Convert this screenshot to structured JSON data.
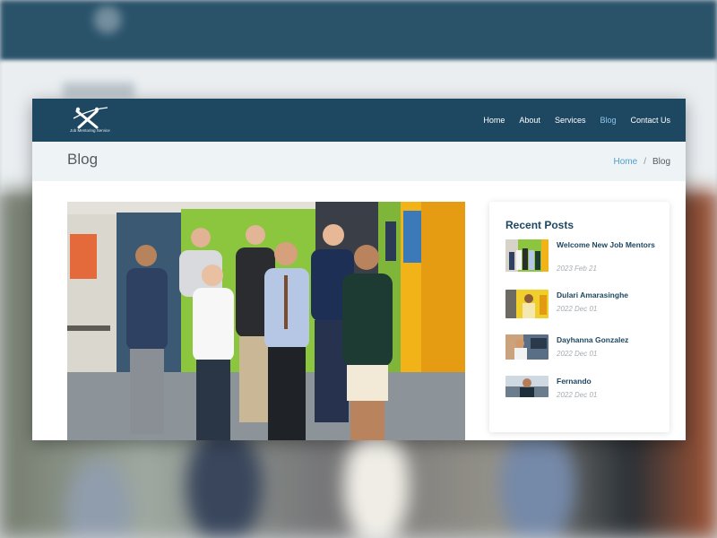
{
  "brand": {
    "logo_text": "Job Mentoring Service"
  },
  "nav": {
    "items": [
      {
        "label": "Home",
        "active": false
      },
      {
        "label": "About",
        "active": false
      },
      {
        "label": "Services",
        "active": false
      },
      {
        "label": "Blog",
        "active": true
      },
      {
        "label": "Contact Us",
        "active": false
      }
    ]
  },
  "page": {
    "title": "Blog",
    "breadcrumb": {
      "home": "Home",
      "separator": "/",
      "current": "Blog"
    }
  },
  "sidebar": {
    "title": "Recent Posts",
    "posts": [
      {
        "title": "Welcome New Job Mentors",
        "date": "2023 Feb 21"
      },
      {
        "title": "Dulari Amarasinghe",
        "date": "2022 Dec 01"
      },
      {
        "title": "Dayhanna Gonzalez",
        "date": "2022 Dec 01"
      },
      {
        "title": "Fernando",
        "date": "2022 Dec 01"
      }
    ]
  },
  "colors": {
    "nav_bg": "#1e4762",
    "active_link": "#8fc7e8",
    "breadcrumb_link": "#4d9fcd",
    "accent_title": "#1e4762"
  }
}
